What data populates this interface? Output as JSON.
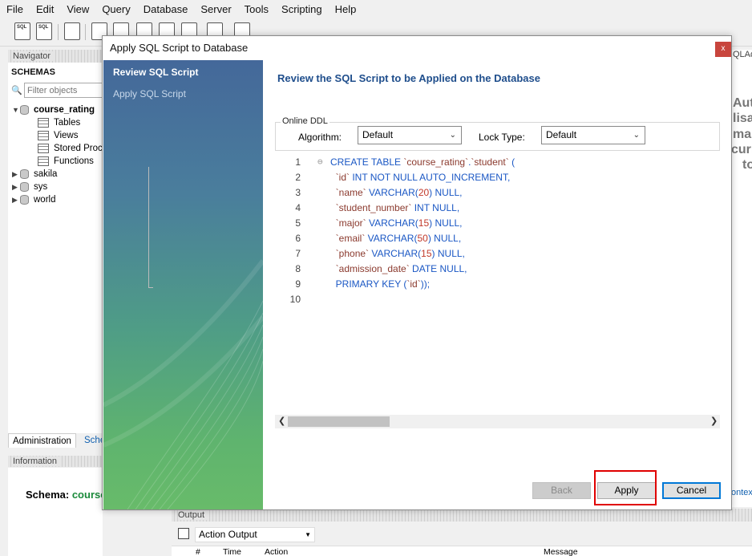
{
  "menu": [
    "File",
    "Edit",
    "View",
    "Query",
    "Database",
    "Server",
    "Tools",
    "Scripting",
    "Help"
  ],
  "toolbar": {
    "new_sql_tab_icon": "SQL",
    "open_sql_file_icon": "SQL"
  },
  "navigator": {
    "header": "Navigator",
    "schemas_label": "SCHEMAS",
    "filter_placeholder": "Filter objects",
    "tree": {
      "course_rating": "course_rating",
      "tables": "Tables",
      "views": "Views",
      "stored_procedures": "Stored Proce",
      "functions": "Functions",
      "sakila": "sakila",
      "sys": "sys",
      "world": "world"
    },
    "tab_administration": "Administration",
    "tab_schemas": "Sche",
    "information_header": "Information",
    "schema_label": "Schema:",
    "schema_value": "course_"
  },
  "right_pane": {
    "tab_label": "QLAdd",
    "lines": [
      "Aut",
      "lisa",
      "ma",
      "curr",
      "to"
    ],
    "context_link": "ontext"
  },
  "output": {
    "header": "Output",
    "select_value": "Action Output",
    "columns": [
      "#",
      "Time",
      "Action",
      "Message"
    ]
  },
  "dialog": {
    "title": "Apply SQL Script to Database",
    "close_glyph": "x",
    "steps": [
      "Review SQL Script",
      "Apply SQL Script"
    ],
    "heading": "Review the SQL Script to be Applied on the Database",
    "online_ddl": {
      "legend": "Online DDL",
      "algorithm_label": "Algorithm:",
      "algorithm_value": "Default",
      "lock_type_label": "Lock Type:",
      "lock_type_value": "Default"
    },
    "code_lines": [
      {
        "n": "1",
        "parts": [
          [
            "k",
            "CREATE TABLE "
          ],
          [
            "s",
            "`course_rating`"
          ],
          [
            "k",
            "."
          ],
          [
            "s",
            "`student`"
          ],
          [
            "k",
            " ("
          ]
        ]
      },
      {
        "n": "2",
        "parts": [
          [
            "k",
            "  "
          ],
          [
            "s",
            "`id`"
          ],
          [
            "k",
            " INT NOT NULL AUTO_INCREMENT,"
          ]
        ]
      },
      {
        "n": "3",
        "parts": [
          [
            "k",
            "  "
          ],
          [
            "s",
            "`name`"
          ],
          [
            "k",
            " VARCHAR("
          ],
          [
            "m",
            "20"
          ],
          [
            "k",
            ") NULL,"
          ]
        ]
      },
      {
        "n": "4",
        "parts": [
          [
            "k",
            "  "
          ],
          [
            "s",
            "`student_number`"
          ],
          [
            "k",
            " INT NULL,"
          ]
        ]
      },
      {
        "n": "5",
        "parts": [
          [
            "k",
            "  "
          ],
          [
            "s",
            "`major`"
          ],
          [
            "k",
            " VARCHAR("
          ],
          [
            "m",
            "15"
          ],
          [
            "k",
            ") NULL,"
          ]
        ]
      },
      {
        "n": "6",
        "parts": [
          [
            "k",
            "  "
          ],
          [
            "s",
            "`email`"
          ],
          [
            "k",
            " VARCHAR("
          ],
          [
            "m",
            "50"
          ],
          [
            "k",
            ") NULL,"
          ]
        ]
      },
      {
        "n": "7",
        "parts": [
          [
            "k",
            "  "
          ],
          [
            "s",
            "`phone`"
          ],
          [
            "k",
            " VARCHAR("
          ],
          [
            "m",
            "15"
          ],
          [
            "k",
            ") NULL,"
          ]
        ]
      },
      {
        "n": "8",
        "parts": [
          [
            "k",
            "  "
          ],
          [
            "s",
            "`admission_date`"
          ],
          [
            "k",
            " DATE NULL,"
          ]
        ]
      },
      {
        "n": "9",
        "parts": [
          [
            "k",
            "  PRIMARY KEY ("
          ],
          [
            "s",
            "`id`"
          ],
          [
            "k",
            "));"
          ]
        ]
      },
      {
        "n": "10",
        "parts": []
      }
    ],
    "buttons": {
      "back": "Back",
      "apply": "Apply",
      "cancel": "Cancel"
    },
    "highlight_color": "#e00000",
    "cancel_border_color": "#0078d7"
  }
}
